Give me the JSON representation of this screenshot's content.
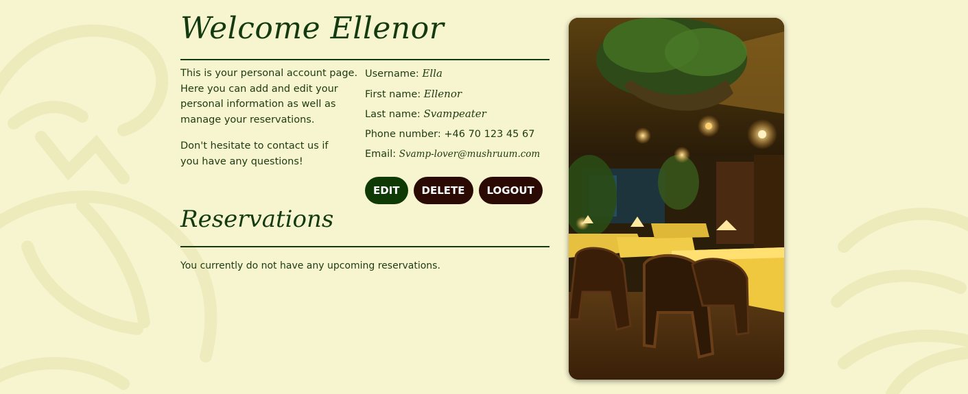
{
  "account": {
    "title": "Welcome Ellenor",
    "intro_p1": "This is your personal account page. Here you can add and edit your personal information as well as manage your reservations.",
    "intro_p2": "Don't hesitate to contact us if you have any questions!"
  },
  "details": {
    "username_label": "Username:",
    "username_value": "Ella",
    "firstname_label": "First name:",
    "firstname_value": "Ellenor",
    "lastname_label": "Last name:",
    "lastname_value": "Svampeater",
    "phone_label": "Phone number:",
    "phone_value": "+46 70 123 45 67",
    "email_label": "Email:",
    "email_value": "Svamp-lover@mushruum.com"
  },
  "buttons": {
    "edit": "EDIT",
    "delete": "DELETE",
    "logout": "LOGOUT"
  },
  "reservations": {
    "title": "Reservations",
    "empty_message": "You currently do not have any upcoming reservations."
  },
  "colors": {
    "background": "#f7f5cf",
    "primary_green": "#143a10",
    "edit_button": "#0f3a06",
    "dark_button": "#2b0a04"
  }
}
